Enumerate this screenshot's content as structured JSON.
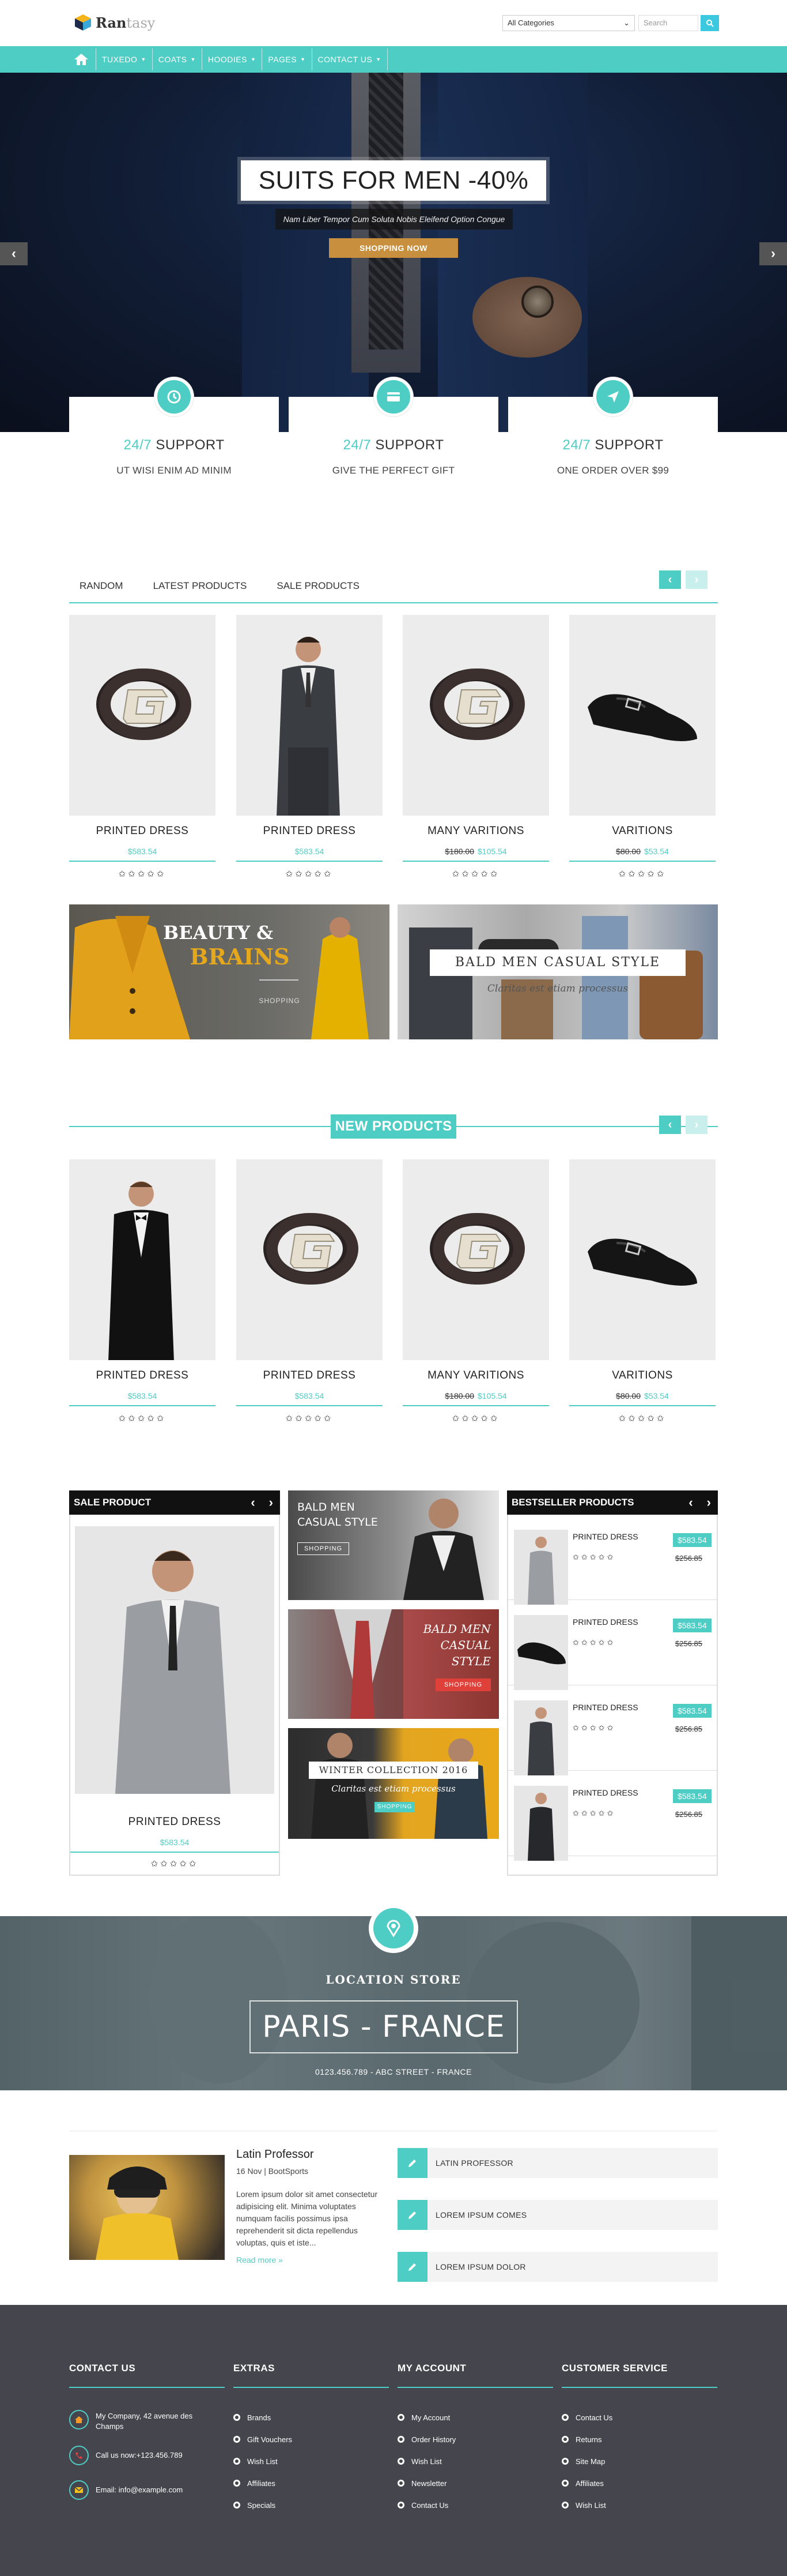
{
  "header": {
    "logo_text": "Rantasy",
    "logo_bold": "Ran",
    "logo_light": "tasy",
    "category_select": "All Categories",
    "search_placeholder": "Search"
  },
  "nav": {
    "items": [
      "TUXEDO",
      "COATS",
      "HOODIES",
      "PAGES",
      "CONTACT US"
    ]
  },
  "hero": {
    "title": "SUITS FOR MEN -40%",
    "subtitle": "Nam Liber Tempor Cum Soluta Nobis Eleifend Option Congue",
    "button": "SHOPPING NOW",
    "prev": "‹",
    "next": "›"
  },
  "support": [
    {
      "accent": "24/7",
      "title": "SUPPORT",
      "sub": "UT WISI ENIM AD MINIM",
      "icon": "clock-icon"
    },
    {
      "accent": "24/7",
      "title": "SUPPORT",
      "sub": "GIVE THE PERFECT GIFT",
      "icon": "card-icon"
    },
    {
      "accent": "24/7",
      "title": "SUPPORT",
      "sub": "ONE ORDER OVER $99",
      "icon": "plane-icon"
    }
  ],
  "tabs": [
    "RANDOM",
    "LATEST PRODUCTS",
    "SALE PRODUCTS"
  ],
  "products_top": [
    {
      "name": "PRINTED DRESS",
      "old": "",
      "price": "$583.54",
      "stars": "✩✩✩✩✩",
      "image": "belt"
    },
    {
      "name": "PRINTED DRESS",
      "old": "",
      "price": "$583.54",
      "stars": "✩✩✩✩✩",
      "image": "man-grey-suit"
    },
    {
      "name": "MANY VARITIONS",
      "old": "$180.00",
      "price": "$105.54",
      "stars": "✩✩✩✩✩",
      "image": "belt"
    },
    {
      "name": "VARITIONS",
      "old": "$80.00",
      "price": "$53.54",
      "stars": "✩✩✩✩✩",
      "image": "shoe"
    }
  ],
  "banners_wide": {
    "left_line1": "BEAUTY &",
    "left_line2": "BRAINS",
    "left_small": "SHOPPING",
    "right_title": "BALD MEN CASUAL STYLE",
    "right_sub": "Claritas est etiam processus"
  },
  "new_products": {
    "title": "NEW PRODUCTS",
    "items": [
      {
        "name": "PRINTED DRESS",
        "old": "",
        "price": "$583.54",
        "stars": "✩✩✩✩✩",
        "image": "man-tuxedo"
      },
      {
        "name": "PRINTED DRESS",
        "old": "",
        "price": "$583.54",
        "stars": "✩✩✩✩✩",
        "image": "belt"
      },
      {
        "name": "MANY VARITIONS",
        "old": "$180.00",
        "price": "$105.54",
        "stars": "✩✩✩✩✩",
        "image": "belt"
      },
      {
        "name": "VARITIONS",
        "old": "$80.00",
        "price": "$53.54",
        "stars": "✩✩✩✩✩",
        "image": "shoe"
      }
    ]
  },
  "sale_product": {
    "header": "SALE PRODUCT",
    "name": "PRINTED DRESS",
    "price": "$583.54",
    "stars": "✩✩✩✩✩"
  },
  "mid_banners": {
    "b1_title": "BALD MEN CASUAL STYLE",
    "b1_btn": "SHOPPING",
    "b2_title": "BALD MEN CASUAL STYLE",
    "b2_btn": "SHOPPING",
    "b3_title": "WINTER COLLECTION 2016",
    "b3_sub": "Claritas est etiam processus",
    "b3_btn": "SHOPPING"
  },
  "bestseller": {
    "header": "BESTSELLER PRODUCTS",
    "items": [
      {
        "name": "PRINTED DRESS",
        "price": "$583.54",
        "old": "$256.85",
        "stars": "✩✩✩✩✩"
      },
      {
        "name": "PRINTED DRESS",
        "price": "$583.54",
        "old": "$256.85",
        "stars": "✩✩✩✩✩"
      },
      {
        "name": "PRINTED DRESS",
        "price": "$583.54",
        "old": "$256.85",
        "stars": "✩✩✩✩✩"
      },
      {
        "name": "PRINTED DRESS",
        "price": "$583.54",
        "old": "$256.85",
        "stars": "✩✩✩✩✩"
      }
    ]
  },
  "location": {
    "label": "LOCATION STORE",
    "city": "PARIS - FRANCE",
    "info": "0123.456.789  -  ABC STREET - FRANCE"
  },
  "blog": {
    "title": "Latin Professor",
    "meta": "16 Nov | BootSports",
    "body": "Lorem ipsum dolor sit amet consectetur adipisicing elit. Minima voluptates numquam facilis possimus ipsa reprehenderit sit dicta repellendus voluptas, quis et iste...",
    "more": "Read more »",
    "links": [
      "LATIN PROFESSOR",
      "LOREM IPSUM COMES",
      "LOREM IPSUM DOLOR"
    ]
  },
  "footer": {
    "contact": {
      "title": "CONTACT US",
      "address": "My Company, 42 avenue des Champs",
      "phone": "Call us now:+123.456.789",
      "email": "Email: info@example.com"
    },
    "extras": {
      "title": "EXTRAS",
      "links": [
        "Brands",
        "Gift Vouchers",
        "Wish List",
        "Affiliates",
        "Specials"
      ]
    },
    "account": {
      "title": "MY ACCOUNT",
      "links": [
        "My Account",
        "Order History",
        "Wish List",
        "Newsletter",
        "Contact Us"
      ]
    },
    "service": {
      "title": "CUSTOMER SERVICE",
      "links": [
        "Contact Us",
        "Returns",
        "Site Map",
        "Affiliates",
        "Wish List"
      ]
    }
  },
  "colors": {
    "accent": "#4ecdc4",
    "search_btn": "#3cc9e0",
    "hero_btn": "#c88f3e",
    "footer_bg": "#45454d"
  }
}
